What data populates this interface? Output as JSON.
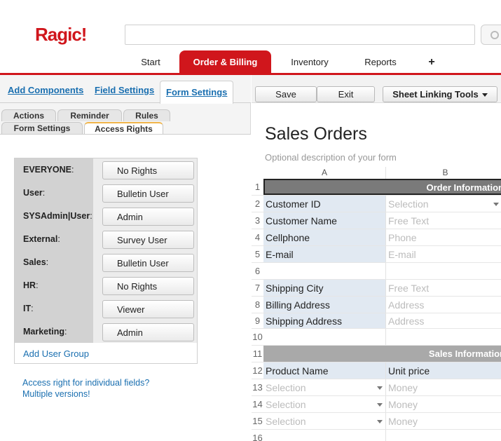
{
  "app": {
    "logo": "Ragic!"
  },
  "main_tabs": [
    {
      "label": "Start"
    },
    {
      "label": "Order & Billing"
    },
    {
      "label": "Inventory"
    },
    {
      "label": "Reports"
    },
    {
      "label": "+"
    }
  ],
  "design_tabs": [
    {
      "label": "Add Components"
    },
    {
      "label": "Field Settings"
    },
    {
      "label": "Form Settings"
    }
  ],
  "setting_tabs": {
    "row1": [
      "Actions",
      "Reminder",
      "Rules"
    ],
    "row2": [
      "Form Settings",
      "Access Rights"
    ]
  },
  "access_rights": [
    {
      "group": "EVERYONE",
      "right": "No Rights"
    },
    {
      "group": "User",
      "right": "Bulletin User"
    },
    {
      "group": "SYSAdmin|User",
      "right": "Admin"
    },
    {
      "group": "External",
      "right": "Survey User"
    },
    {
      "group": "Sales",
      "right": "Bulletin User"
    },
    {
      "group": "HR",
      "right": "No Rights"
    },
    {
      "group": "IT",
      "right": "Viewer"
    },
    {
      "group": "Marketing",
      "right": "Admin"
    }
  ],
  "add_group_label": "Add User Group",
  "help_links": [
    "Access right for individual fields?",
    "Multiple versions!"
  ],
  "toolbar": {
    "save": "Save",
    "exit": "Exit",
    "linking": "Sheet Linking Tools"
  },
  "form": {
    "title": "Sales Orders",
    "description": "Optional description of your form",
    "columns": [
      "A",
      "B"
    ],
    "rows": [
      {
        "n": "1",
        "type": "header",
        "text": "Order Information"
      },
      {
        "n": "2",
        "a": "Customer ID",
        "b": "Selection",
        "dropdown_b": true
      },
      {
        "n": "3",
        "a": "Customer Name",
        "b": "Free Text"
      },
      {
        "n": "4",
        "a": "Cellphone",
        "b": "Phone"
      },
      {
        "n": "5",
        "a": "E-mail",
        "b": "E-mail"
      },
      {
        "n": "6",
        "type": "empty"
      },
      {
        "n": "7",
        "a": "Shipping City",
        "b": "Free Text"
      },
      {
        "n": "8",
        "a": "Billing Address",
        "b": "Address"
      },
      {
        "n": "9",
        "a": "Shipping Address",
        "b": "Address"
      },
      {
        "n": "10",
        "type": "empty"
      },
      {
        "n": "11",
        "type": "header",
        "text": "Sales Information"
      },
      {
        "n": "12",
        "a": "Product Name",
        "b": "Unit price",
        "b_label": true
      },
      {
        "n": "13",
        "a": "Selection",
        "b": "Money",
        "a_placeholder": true,
        "dropdown_a": true
      },
      {
        "n": "14",
        "a": "Selection",
        "b": "Money",
        "a_placeholder": true,
        "dropdown_a": true
      },
      {
        "n": "15",
        "a": "Selection",
        "b": "Money",
        "a_placeholder": true,
        "dropdown_a": true
      },
      {
        "n": "16",
        "type": "empty"
      }
    ]
  }
}
